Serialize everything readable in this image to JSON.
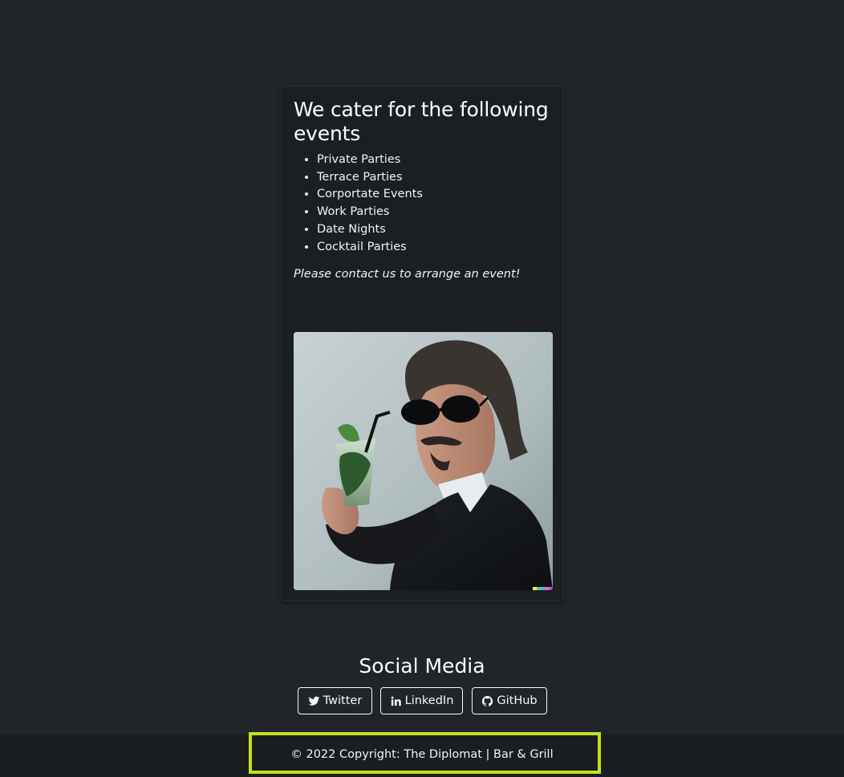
{
  "card": {
    "title": "We cater for the following events",
    "events": [
      "Private Parties",
      "Terrace Parties",
      "Corportate Events",
      "Work Parties",
      "Date Nights",
      "Cocktail Parties"
    ],
    "note": "Please contact us to arrange an event!"
  },
  "social": {
    "title": "Social Media",
    "buttons": [
      {
        "label": "Twitter",
        "icon": "twitter-icon"
      },
      {
        "label": "LinkedIn",
        "icon": "linkedin-icon"
      },
      {
        "label": "GitHub",
        "icon": "github-icon"
      }
    ]
  },
  "footer": {
    "copyright": "© 2022 Copyright: The Diplomat | Bar & Grill",
    "highlight_color": "#c4e01c"
  },
  "theme": {
    "background": "#212529",
    "card_background": "#1c1f22",
    "footer_background": "#1b1e21",
    "text": "#f8f9fa"
  }
}
